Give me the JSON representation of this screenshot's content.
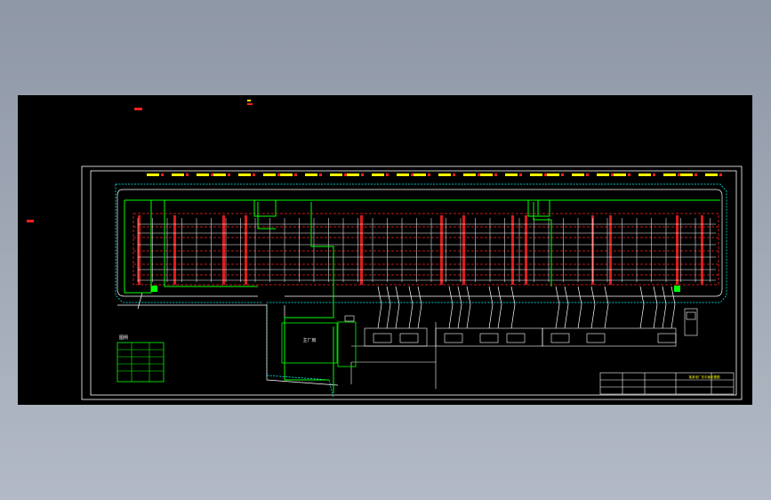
{
  "viewport": {
    "background": "#000000",
    "outer_background": "#9aa2b0"
  },
  "drawing": {
    "labels": {
      "main_building": "主厂房"
    },
    "legend": {
      "title": "图例",
      "rows": 5
    },
    "title_block": {
      "project": "某某电厂总平面布置图"
    },
    "colors": {
      "frame": "#ffffff",
      "cable": "#00ff00",
      "dash_red": "#ff2020",
      "cyan": "#00ffff",
      "yellow": "#ffff00",
      "magenta": "#ff00ff"
    }
  }
}
